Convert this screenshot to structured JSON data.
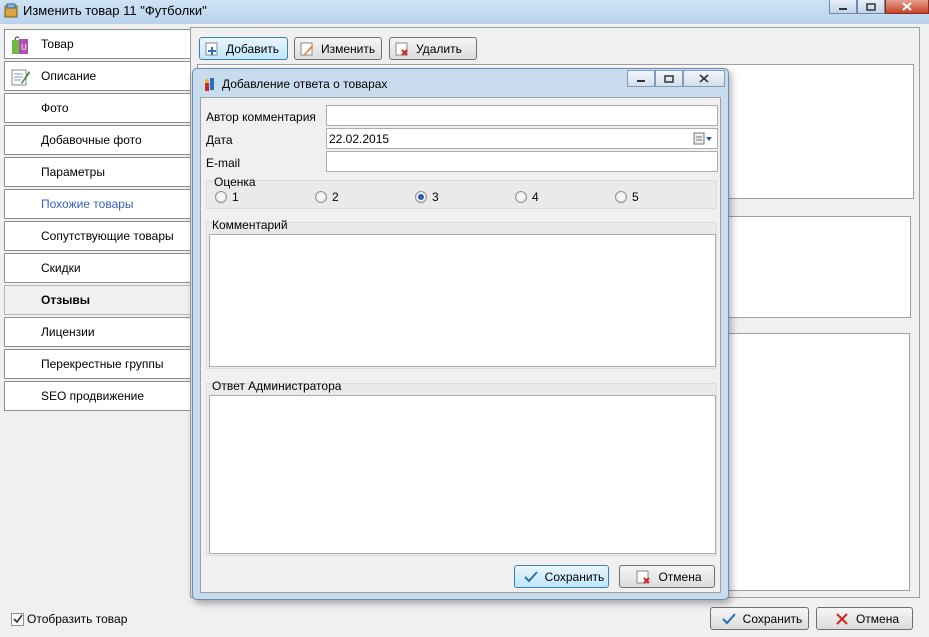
{
  "window": {
    "title": "Изменить товар 11 \"Футболки\""
  },
  "sidebar": {
    "items": [
      {
        "label": "Товар",
        "icon": "shopping-bag-icon",
        "state": "normal"
      },
      {
        "label": "Описание",
        "icon": "document-edit-icon",
        "state": "normal"
      },
      {
        "label": "Фото",
        "icon": "",
        "state": "normal"
      },
      {
        "label": "Добавочные фото",
        "icon": "",
        "state": "normal"
      },
      {
        "label": "Параметры",
        "icon": "",
        "state": "normal"
      },
      {
        "label": "Похожие товары",
        "icon": "",
        "state": "link"
      },
      {
        "label": "Сопутствующие товары",
        "icon": "",
        "state": "normal"
      },
      {
        "label": "Скидки",
        "icon": "",
        "state": "normal"
      },
      {
        "label": "Отзывы",
        "icon": "",
        "state": "active"
      },
      {
        "label": "Лицензии",
        "icon": "",
        "state": "normal"
      },
      {
        "label": "Перекрестные группы",
        "icon": "",
        "state": "normal"
      },
      {
        "label": "SEO продвижение",
        "icon": "",
        "state": "normal"
      }
    ]
  },
  "toolbar": {
    "add_label": "Добавить",
    "edit_label": "Изменить",
    "delete_label": "Удалить"
  },
  "footer": {
    "show_product_label": "Отобразить товар",
    "show_product_checked": true,
    "save_label": "Сохранить",
    "cancel_label": "Отмена"
  },
  "dialog": {
    "title": "Добавление ответа о товарах",
    "author_label": "Автор комментария",
    "author_value": "",
    "date_label": "Дата",
    "date_value": "22.02.2015",
    "email_label": "E-mail",
    "email_value": "",
    "rating": {
      "title": "Оценка",
      "options": [
        "1",
        "2",
        "3",
        "4",
        "5"
      ],
      "selected": "3"
    },
    "comment_label": "Комментарий",
    "admin_reply_label": "Ответ Администратора",
    "save_label": "Сохранить",
    "cancel_label": "Отмена"
  },
  "colors": {
    "link": "#3b5fc0",
    "accent": "#3c7fb1"
  }
}
